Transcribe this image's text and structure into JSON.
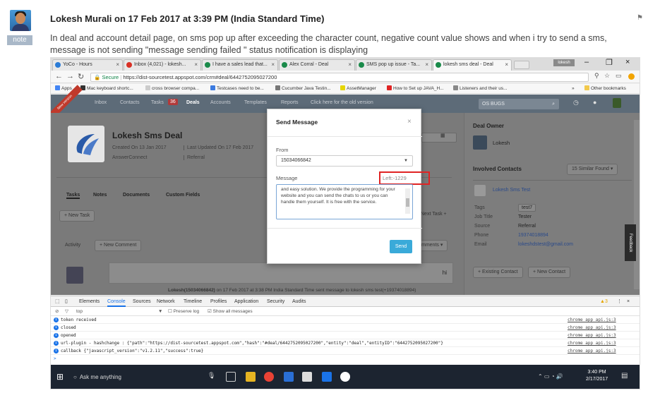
{
  "note": {
    "tag": "note",
    "title": "Lokesh Murali on 17 Feb 2017 at 3:39 PM (India Standard Time)",
    "body": "In deal and account detail page, on sms pop up after exceeding the character count, negative count value shows and when i try to send a sms, message is not sending \"message sending failed \" status notification is displaying"
  },
  "browser": {
    "tabs": [
      {
        "label": "YoCo - Hours",
        "color": "#2a7bd6"
      },
      {
        "label": "Inbox (4,021) - lokesh...",
        "color": "#d93025"
      },
      {
        "label": "I have a sales lead that...",
        "color": "#1a8a4a"
      },
      {
        "label": "Alex Corral - Deal",
        "color": "#1a8a4a"
      },
      {
        "label": "SMS pop up issue - Ta...",
        "color": "#1a8a4a"
      },
      {
        "label": "lokesh sms deal - Deal",
        "color": "#1a8a4a"
      }
    ],
    "user_chip": "lokesh",
    "secure_label": "Secure",
    "url": "https://dist-sourcetest.appspot.com/crm#deal/6442752095027200",
    "bookmarks": [
      "Apps",
      "Mac keyboard shortc...",
      "cross browser compa...",
      "Testcases need to be...",
      "Cucumber Java Testin...",
      "AssetManager",
      "How to Set up JAVA_H...",
      "Listeners and their us..."
    ],
    "other_bookmarks": "Other bookmarks"
  },
  "app": {
    "ribbon": "New version",
    "nav": [
      "Inbox",
      "Contacts",
      "Tasks",
      "Deals",
      "Accounts",
      "Templates",
      "Reports",
      "Click here for the old version"
    ],
    "tasks_badge": "36",
    "search_text": "OS BUGS",
    "deal_title": "Lokesh Sms Deal",
    "created": "Created On 13 Jan 2017",
    "updated": "Last Updated On 17 Feb 2017",
    "account": "AnswerConnect",
    "source": "Referral",
    "detail_tabs": [
      "Tasks",
      "Notes",
      "Documents",
      "Custom Fields"
    ],
    "new_task": "+ New Task",
    "next_task": "Next Task +",
    "activity": "Activity",
    "new_comment": "+ New Comment",
    "comments_label": "mments",
    "comment_text": "hi",
    "log_line_name": "Lokesh(15034066842)",
    "log_line": " on 17 Feb 2017 at 3:38 PM India Standard Time sent message to lokesh sms test(+19374018894)",
    "deal_owner_heading": "Deal Owner",
    "owner_name": "Lokesh",
    "involved_heading": "Involved Contacts",
    "similar_found": "15 Similar Found",
    "contact_name": "Lokesh Sms Test",
    "fields": [
      {
        "label": "Tags",
        "value": "test7"
      },
      {
        "label": "Job Title",
        "value": "Tester"
      },
      {
        "label": "Source",
        "value": "Referral"
      },
      {
        "label": "Phone",
        "value": "19374018894"
      },
      {
        "label": "Email",
        "value": "lokeshdstest@gmail.com"
      }
    ],
    "existing_contact": "+ Existing Contact",
    "new_contact": "+ New Contact",
    "feedback": "Feedback"
  },
  "modal": {
    "title": "Send Message",
    "close": "×",
    "from_label": "From",
    "from_value": "15034066842",
    "message_label": "Message",
    "left_count": "Left:-1229",
    "message_text": "and easy solution. We provide the programming for your website and you can send the chats to us or you can handle them yourself. It is free with the service.",
    "send_label": "Send"
  },
  "devtools": {
    "tabs": [
      "Elements",
      "Console",
      "Sources",
      "Network",
      "Timeline",
      "Profiles",
      "Application",
      "Security",
      "Audits"
    ],
    "warn_count": "3",
    "context": "top",
    "preserve_log": "Preserve log",
    "show_all": "Show all messages",
    "rows": [
      {
        "text": "token received",
        "src": "chrome_app_api.js:3"
      },
      {
        "text": "closed",
        "src": "chrome_app_api.js:3"
      },
      {
        "text": "opened",
        "src": "chrome_app_api.js:3"
      },
      {
        "text": "url-plugin - hashchange : {\"path\":\"https://dist-sourcetest.appspot.com\",\"hash\":\"#deal/6442752095027200\",\"entity\":\"deal\",\"entityID\":\"6442752095027200\"}",
        "src": "chrome_app_api.js:3"
      },
      {
        "text": "callback {\"javascript_version\":\"v1.2.11\",\"success\":true}",
        "src": "chrome_app_api.js:3"
      }
    ],
    "prompt": ">"
  },
  "taskbar": {
    "search": "Ask me anything",
    "time": "3:40 PM",
    "date": "2/17/2017"
  }
}
